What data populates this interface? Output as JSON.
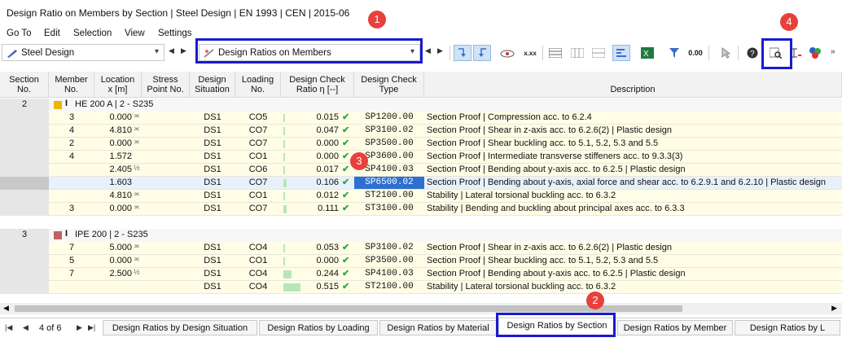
{
  "window": {
    "title": "Design Ratio on Members by Section | Steel Design | EN 1993 | CEN | 2015-06"
  },
  "menu": [
    "Go To",
    "Edit",
    "Selection",
    "View",
    "Settings"
  ],
  "toolbar": {
    "module_combo": "Steel Design",
    "table_combo": "Design Ratios on Members"
  },
  "columns": [
    "Section\nNo.",
    "Member\nNo.",
    "Location\nx [m]",
    "Stress\nPoint No.",
    "Design\nSituation",
    "Loading\nNo.",
    "Design Check\nRatio η [--]",
    "Design Check\nType",
    "Description"
  ],
  "groups": [
    {
      "section_no": "2",
      "section_name": "HE 200 A | 2 - S235",
      "color": "#f0b400",
      "rows": [
        {
          "member": "3",
          "location": "0.000",
          "loc_sym": "≍",
          "situation": "DS1",
          "loading": "CO5",
          "ratio": "0.015",
          "ratio_val": 0.015,
          "type": "SP1200.00",
          "desc": "Section Proof | Compression acc. to 6.2.4"
        },
        {
          "member": "4",
          "location": "4.810",
          "loc_sym": "≍",
          "situation": "DS1",
          "loading": "CO7",
          "ratio": "0.047",
          "ratio_val": 0.047,
          "type": "SP3100.02",
          "desc": "Section Proof | Shear in z-axis acc. to 6.2.6(2) | Plastic design"
        },
        {
          "member": "2",
          "location": "0.000",
          "loc_sym": "≍",
          "situation": "DS1",
          "loading": "CO7",
          "ratio": "0.000",
          "ratio_val": 0.0,
          "type": "SP3500.00",
          "desc": "Section Proof | Shear buckling acc. to 5.1, 5.2, 5.3 and 5.5"
        },
        {
          "member": "4",
          "location": "1.572",
          "loc_sym": "",
          "situation": "DS1",
          "loading": "CO1",
          "ratio": "0.000",
          "ratio_val": 0.0,
          "type": "SP3600.00",
          "desc": "Section Proof | Intermediate transverse stiffeners acc. to 9.3.3(3)"
        },
        {
          "member": "",
          "location": "2.405",
          "loc_sym": "½",
          "situation": "DS1",
          "loading": "CO6",
          "ratio": "0.017",
          "ratio_val": 0.017,
          "type": "SP4100.03",
          "desc": "Section Proof | Bending about y-axis acc. to 6.2.5 | Plastic design"
        },
        {
          "member": "",
          "location": "1.603",
          "loc_sym": "",
          "situation": "DS1",
          "loading": "CO7",
          "ratio": "0.106",
          "ratio_val": 0.106,
          "type": "SP6500.02",
          "desc": "Section Proof | Bending about y-axis, axial force and shear acc. to 6.2.9.1 and 6.2.10 | Plastic design",
          "selected": true
        },
        {
          "member": "",
          "location": "4.810",
          "loc_sym": "≍",
          "situation": "DS1",
          "loading": "CO1",
          "ratio": "0.012",
          "ratio_val": 0.012,
          "type": "ST2100.00",
          "desc": "Stability | Lateral torsional buckling acc. to 6.3.2"
        },
        {
          "member": "3",
          "location": "0.000",
          "loc_sym": "≍",
          "situation": "DS1",
          "loading": "CO7",
          "ratio": "0.111",
          "ratio_val": 0.111,
          "type": "ST3100.00",
          "desc": "Stability | Bending and buckling about principal axes acc. to 6.3.3"
        }
      ]
    },
    {
      "section_no": "3",
      "section_name": "IPE 200 | 2 - S235",
      "color": "#c06060",
      "rows": [
        {
          "member": "7",
          "location": "5.000",
          "loc_sym": "≍",
          "situation": "DS1",
          "loading": "CO4",
          "ratio": "0.053",
          "ratio_val": 0.053,
          "type": "SP3100.02",
          "desc": "Section Proof | Shear in z-axis acc. to 6.2.6(2) | Plastic design"
        },
        {
          "member": "5",
          "location": "0.000",
          "loc_sym": "≍",
          "situation": "DS1",
          "loading": "CO1",
          "ratio": "0.000",
          "ratio_val": 0.0,
          "type": "SP3500.00",
          "desc": "Section Proof | Shear buckling acc. to 5.1, 5.2, 5.3 and 5.5"
        },
        {
          "member": "7",
          "location": "2.500",
          "loc_sym": "½",
          "situation": "DS1",
          "loading": "CO4",
          "ratio": "0.244",
          "ratio_val": 0.244,
          "type": "SP4100.03",
          "desc": "Section Proof | Bending about y-axis acc. to 6.2.5 | Plastic design"
        },
        {
          "member": "",
          "location": "",
          "loc_sym": "",
          "situation": "DS1",
          "loading": "CO4",
          "ratio": "0.515",
          "ratio_val": 0.515,
          "type": "ST2100.00",
          "desc": "Stability | Lateral torsional buckling acc. to 6.3.2"
        }
      ]
    }
  ],
  "pager": {
    "label": "4 of 6"
  },
  "tabs": [
    "Design Ratios by Design Situation",
    "Design Ratios by Loading",
    "Design Ratios by Material",
    "Design Ratios by Section",
    "Design Ratios by Member",
    "Design Ratios by L"
  ],
  "active_tab": 3,
  "callouts": [
    "1",
    "2",
    "3",
    "4"
  ]
}
